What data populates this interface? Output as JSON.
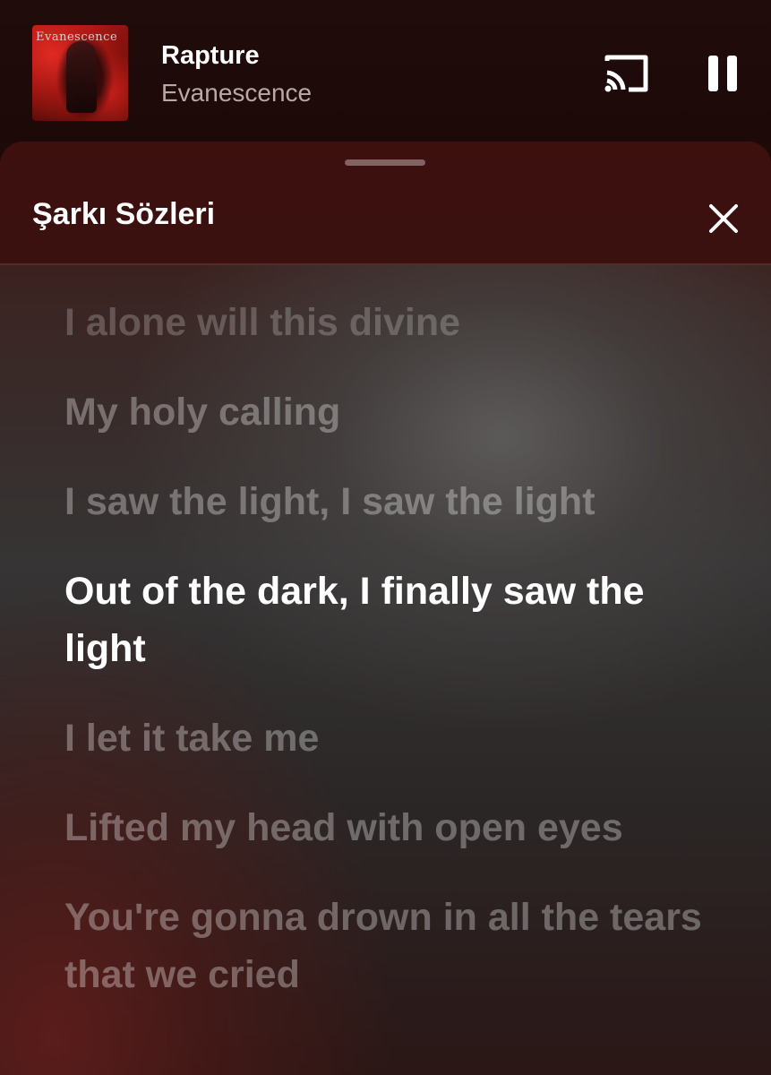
{
  "player": {
    "title": "Rapture",
    "artist": "Evanescence",
    "album_art_wordmark": "Evanescence",
    "cast_icon": "cast-icon",
    "pause_icon": "pause-icon"
  },
  "lyrics_sheet": {
    "title": "Şarkı Sözleri",
    "close_icon": "close-icon",
    "lines": [
      {
        "text": "I alone will this divine",
        "state": "past"
      },
      {
        "text": "My holy calling",
        "state": "past"
      },
      {
        "text": "I saw the light, I saw the light",
        "state": "past"
      },
      {
        "text": "Out of the dark, I finally saw the light",
        "state": "active"
      },
      {
        "text": "I let it take me",
        "state": "upcoming"
      },
      {
        "text": "Lifted my head with open eyes",
        "state": "upcoming"
      },
      {
        "text": "You're gonna drown in all the tears that we cried",
        "state": "upcoming"
      }
    ]
  },
  "colors": {
    "accent_dark_red": "#3d100e",
    "active_lyric": "#ffffff",
    "inactive_lyric": "rgba(255,255,255,0.32)"
  }
}
